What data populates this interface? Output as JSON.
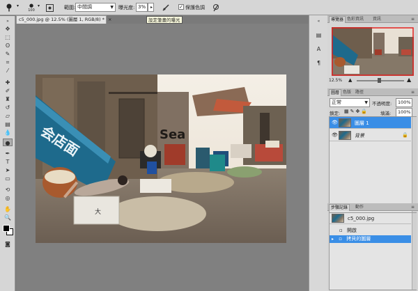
{
  "options_bar": {
    "brush_size": "100",
    "range_label": "範圍:",
    "range_value": "中間調",
    "exposure_label": "曝光度:",
    "exposure_value": "3%",
    "protect_tones_label": "保護色調",
    "protect_tones_checked": true
  },
  "tooltip": "設定筆畫的曝光",
  "document": {
    "tab_title": "c5_000.jpg @ 12.5% (圖層 1, RGB/8) *",
    "zoom": "12.5%"
  },
  "photo_sign": "Sea",
  "photo_banner": "会店面",
  "photo_crate_mark": "大",
  "navigator": {
    "tabs": [
      "導覽器",
      "色彩資訊",
      "資訊"
    ],
    "zoom": "12.5%"
  },
  "layers": {
    "tabs": [
      "圖層",
      "色版",
      "路徑"
    ],
    "blend_mode": "正常",
    "opacity_label": "不透明度:",
    "opacity_value": "100%",
    "lock_label": "鎖定:",
    "fill_label": "填滿:",
    "fill_value": "100%",
    "items": [
      {
        "name": "圖層 1",
        "selected": true
      },
      {
        "name": "背景",
        "selected": false
      }
    ]
  },
  "history": {
    "tabs": [
      "步驟記錄",
      "動作"
    ],
    "snapshot": "c5_000.jpg",
    "items": [
      {
        "name": "開啟",
        "selected": false
      },
      {
        "name": "拷貝的圖層",
        "selected": true
      }
    ]
  },
  "colors": {
    "selection_blue": "#3a8ee6",
    "panel_gray": "#d6d6d6",
    "canvas_gray": "#808080"
  }
}
